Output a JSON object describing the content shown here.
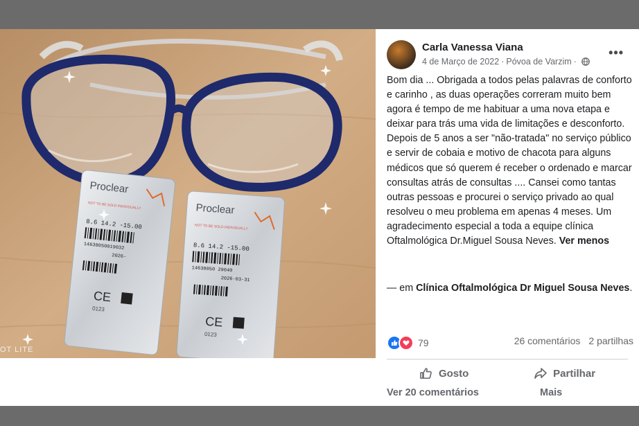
{
  "post": {
    "author": "Carla Vanessa Viana",
    "date": "4 de Março de 2022",
    "location": "Póvoa de Varzim",
    "more_options": "•••",
    "text": "Bom dia ... Obrigada a todos pelas palavras de conforto e carinho , as duas operações correram muito bem agora é tempo de me habituar a uma nova etapa e deixar para trás uma vida de limitações e desconforto. Depois de 5 anos a ser \"não-tratada\" no serviço público e servir de cobaia e motivo de chacota para alguns médicos que só querem é receber o ordenado e marcar consultas atrás de consultas .... Cansei como tantas outras pessoas e procurei o serviço privado ao qual resolveu o meu problema em apenas 4 meses. Um agradecimento especial a toda a equipe clínica Oftalmológica Dr.Miguel Sousa Neves.",
    "see_less": "Ver menos",
    "checkin_prefix": "— em ",
    "checkin_place": "Clínica Oftalmológica Dr Miguel Sousa Neves",
    "checkin_suffix": "."
  },
  "photo": {
    "caption": "OT LITE",
    "pack1": {
      "brand": "Proclear",
      "small_text": "NOT TO BE SOLD INDIVIDUALLY",
      "params": "8.6  14.2  -15.00",
      "code": "14638050019032",
      "date": "2026-",
      "ce": "CE",
      "num": "0123"
    },
    "pack2": {
      "brand": "Proclear",
      "small_text": "NOT TO BE SOLD INDIVIDUALLY",
      "params": "8.6  14.2  -15.00",
      "code": "14638050 29040",
      "date": "2026-03-31",
      "ce": "CE",
      "num": "0123"
    }
  },
  "stats": {
    "reaction_count": "79",
    "comments": "26 comentários",
    "shares": "2 partilhas"
  },
  "actions": {
    "like": "Gosto",
    "share": "Partilhar"
  },
  "footer": {
    "view_comments": "Ver 20 comentários",
    "more": "Mais"
  },
  "icons": [
    "globe-icon",
    "like-reaction-icon",
    "love-reaction-icon",
    "thumbs-up-icon",
    "share-arrow-icon",
    "more-options-icon"
  ],
  "colors": {
    "facebook_blue": "#1877f2",
    "love_red": "#f33e58",
    "frame_blue": "#1e2a6b",
    "table_wood": "#c8a37a"
  }
}
